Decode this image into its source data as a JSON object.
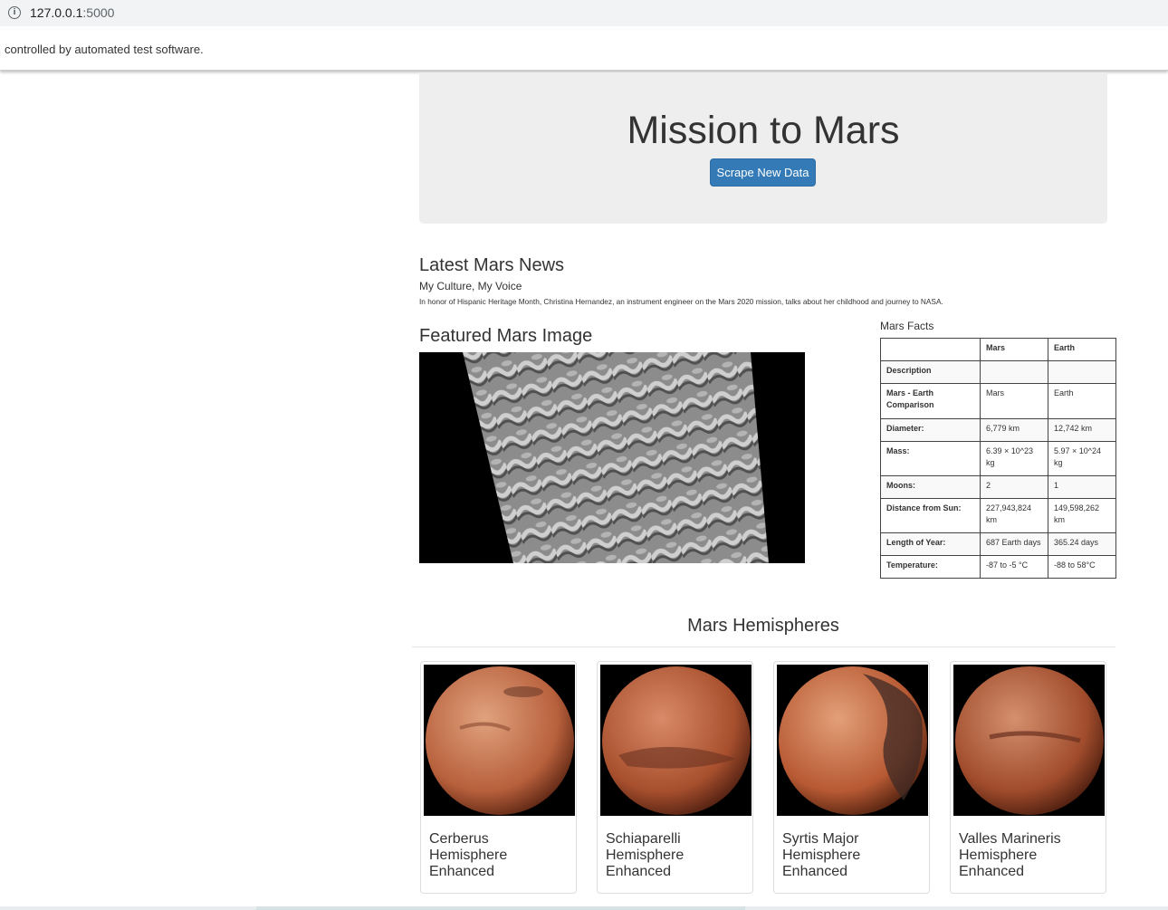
{
  "browser": {
    "url_host": "127.0.0.1",
    "url_port": ":5000",
    "automation_message": "controlled by automated test software."
  },
  "header": {
    "title": "Mission to Mars",
    "scrape_button": "Scrape New Data",
    "button_color": "#337ab7"
  },
  "news": {
    "section_title": "Latest Mars News",
    "headline": "My Culture, My Voice",
    "teaser": "In honor of Hispanic Heritage Month, Christina Hernandez, an instrument engineer on the Mars 2020 mission, talks about her childhood and journey to NASA."
  },
  "featured": {
    "section_title": "Featured Mars Image"
  },
  "facts": {
    "section_title": "Mars Facts",
    "columns": [
      "",
      "Mars",
      "Earth"
    ],
    "rows": [
      {
        "label": "Description",
        "mars": "",
        "earth": ""
      },
      {
        "label": "Mars - Earth Comparison",
        "mars": "Mars",
        "earth": "Earth"
      },
      {
        "label": "Diameter:",
        "mars": "6,779 km",
        "earth": "12,742 km"
      },
      {
        "label": "Mass:",
        "mars": "6.39 × 10^23 kg",
        "earth": "5.97 × 10^24 kg"
      },
      {
        "label": "Moons:",
        "mars": "2",
        "earth": "1"
      },
      {
        "label": "Distance from Sun:",
        "mars": "227,943,824 km",
        "earth": "149,598,262 km"
      },
      {
        "label": "Length of Year:",
        "mars": "687 Earth days",
        "earth": "365.24 days"
      },
      {
        "label": "Temperature:",
        "mars": "-87 to -5 °C",
        "earth": "-88 to 58°C"
      }
    ]
  },
  "hemispheres": {
    "section_title": "Mars Hemispheres",
    "items": [
      {
        "line1": "Cerberus",
        "line2": "Hemisphere",
        "line3": "Enhanced"
      },
      {
        "line1": "Schiaparelli",
        "line2": "Hemisphere",
        "line3": "Enhanced"
      },
      {
        "line1": "Syrtis Major",
        "line2": "Hemisphere",
        "line3": "Enhanced"
      },
      {
        "line1": "Valles Marineris",
        "line2": "Hemisphere",
        "line3": "Enhanced"
      }
    ]
  }
}
